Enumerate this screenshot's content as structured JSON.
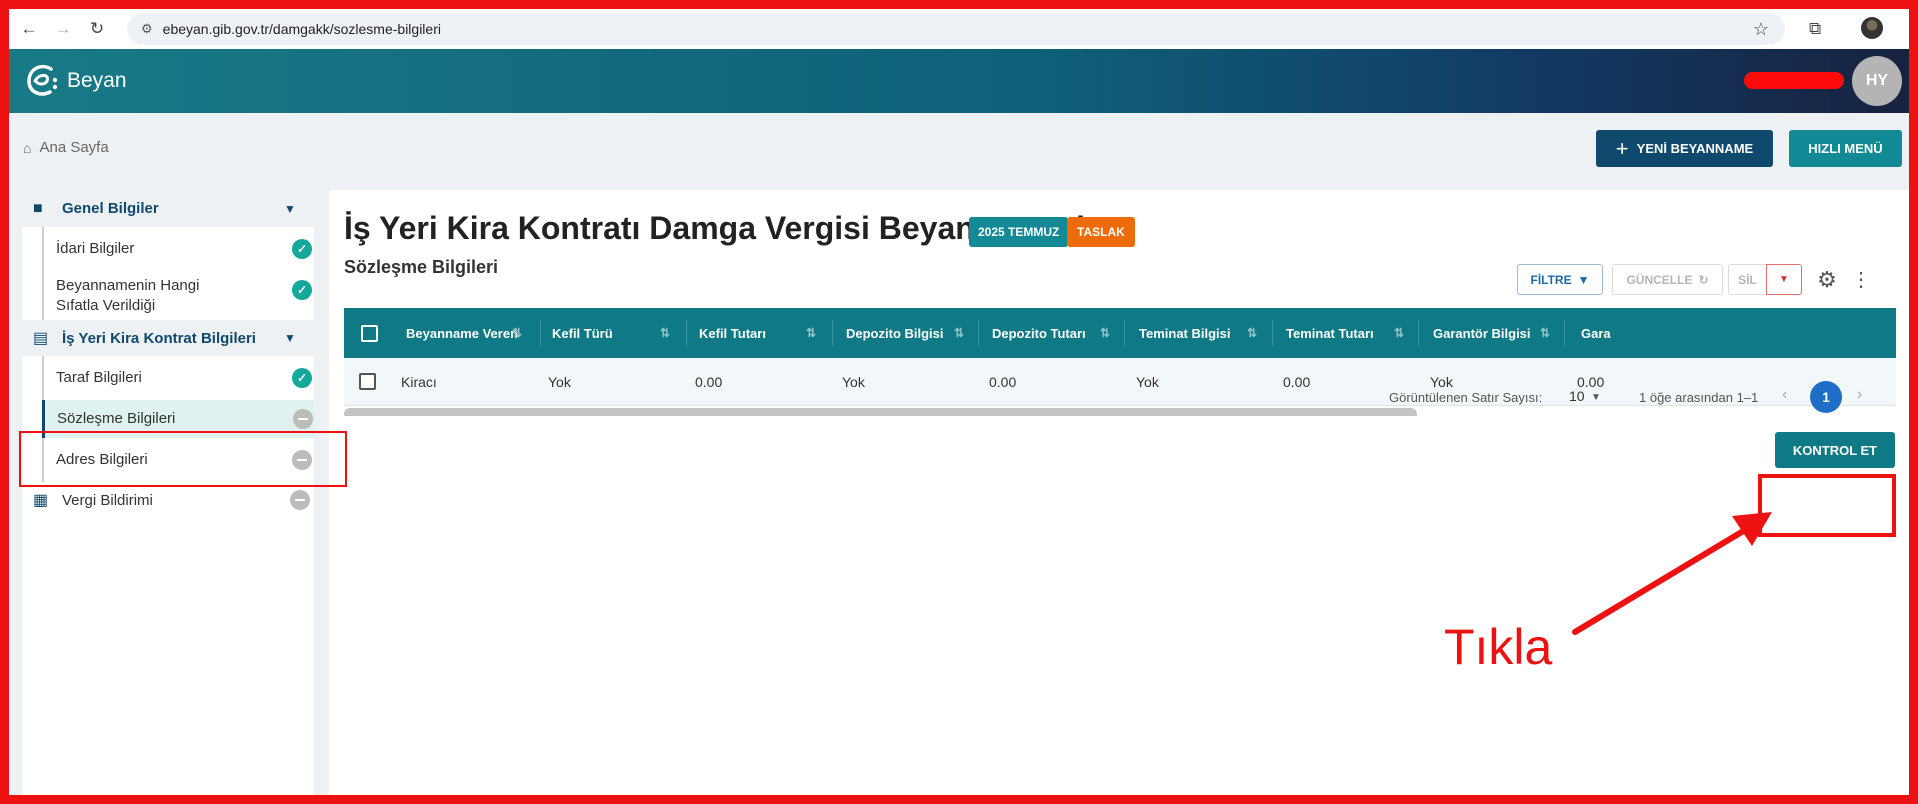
{
  "browser": {
    "url": "ebeyan.gib.gov.tr/damgakk/sozlesme-bilgileri"
  },
  "header": {
    "app_name": "Beyan",
    "user_initials": "HY"
  },
  "breadcrumb": {
    "home": "Ana Sayfa"
  },
  "actions": {
    "new_declaration": "YENİ BEYANNAME",
    "quick_menu": "HIZLI MENÜ"
  },
  "sidebar": {
    "groups": [
      {
        "label": "Genel Bilgiler",
        "icon": "folder-icon"
      },
      {
        "label": "İş Yeri Kira Kontrat Bilgileri",
        "icon": "document-icon"
      }
    ],
    "items": [
      {
        "label": "İdari Bilgiler",
        "status": "done"
      },
      {
        "label": "Beyannamenin Hangi Sıfatla Verildiği",
        "status": "done"
      },
      {
        "label": "Taraf Bilgileri",
        "status": "done"
      },
      {
        "label": "Sözleşme Bilgileri",
        "status": "pending",
        "active": true
      },
      {
        "label": "Adres Bilgileri",
        "status": "pending"
      }
    ],
    "vergi": {
      "label": "Vergi Bildirimi",
      "icon": "building-icon",
      "status": "pending"
    }
  },
  "main": {
    "title": "İş Yeri Kira Kontratı Damga Vergisi Beyannamesi",
    "period_badge": "2025 TEMMUZ",
    "status_badge": "TASLAK",
    "section_title": "Sözleşme Bilgileri",
    "toolbar": {
      "filter": "FİLTRE",
      "update": "GÜNCELLE",
      "delete": "SİL"
    },
    "table": {
      "columns": [
        "Beyanname Veren",
        "Kefil Türü",
        "Kefil Tutarı",
        "Depozito Bilgisi",
        "Depozito Tutarı",
        "Teminat Bilgisi",
        "Teminat Tutarı",
        "Garantör Bilgisi",
        "Gara"
      ],
      "rows": [
        [
          "Kiracı",
          "Yok",
          "0.00",
          "Yok",
          "0.00",
          "Yok",
          "0.00",
          "Yok",
          "0.00"
        ]
      ]
    },
    "pagination": {
      "rows_label": "Görüntülenen Satır Sayısı:",
      "rows_value": "10",
      "range_text": "1 öğe arasından 1–1",
      "current_page": "1"
    },
    "check_button": "KONTROL ET"
  },
  "annotation": {
    "text": "Tıkla",
    "color": "#ee1111"
  },
  "colors": {
    "primary": "#0f4a6e",
    "teal": "#118a96",
    "orange": "#ee6c08",
    "success": "#14a89a"
  }
}
